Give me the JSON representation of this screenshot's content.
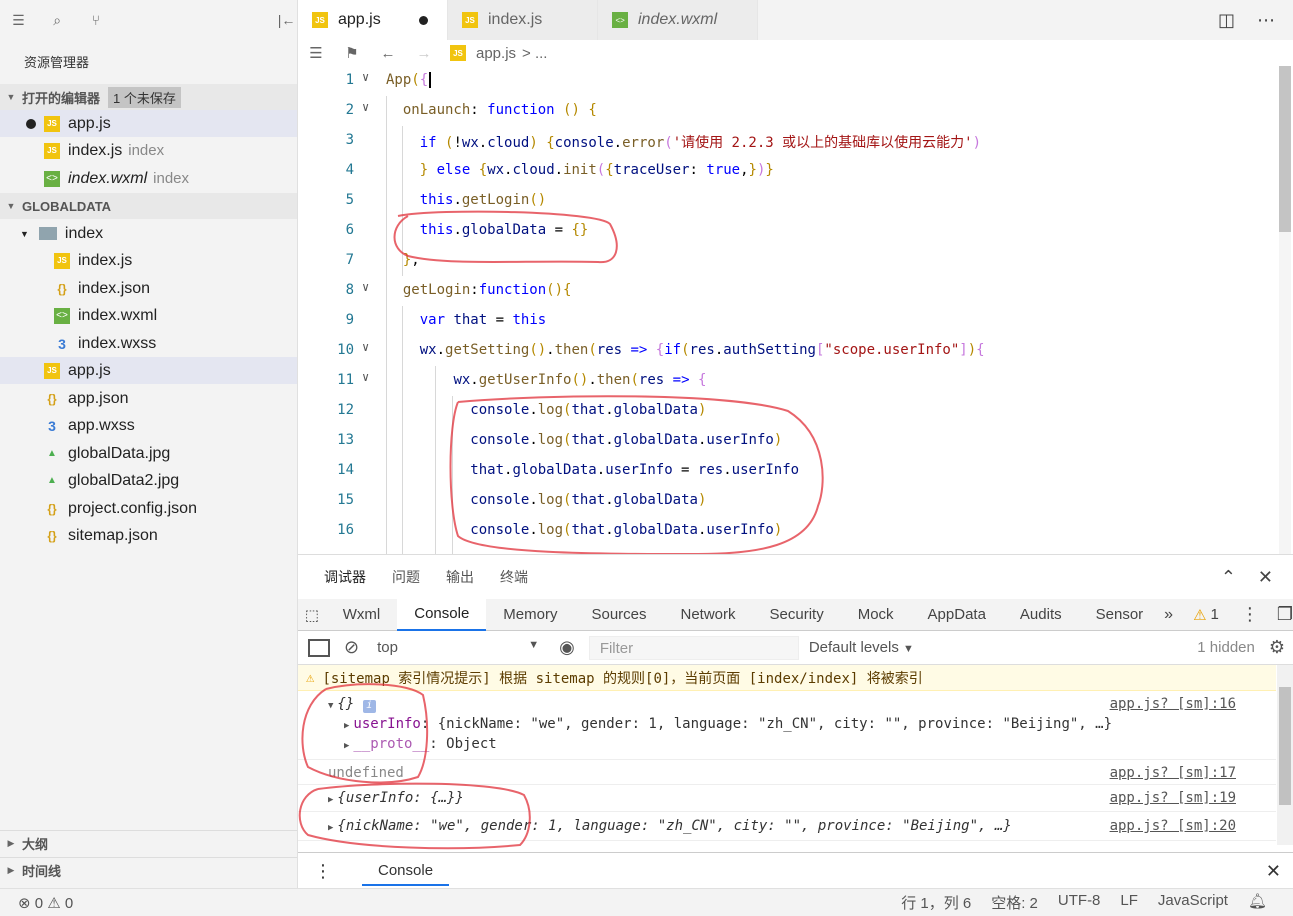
{
  "sidebar": {
    "title": "资源管理器",
    "open_editors": {
      "label": "打开的编辑器",
      "badge": "1 个未保存"
    },
    "open_files": [
      {
        "name": "app.js",
        "hint": ""
      },
      {
        "name": "index.js",
        "hint": "index"
      },
      {
        "name": "index.wxml",
        "hint": "index"
      }
    ],
    "project": "GLOBALDATA",
    "tree": [
      {
        "name": "index"
      },
      {
        "name": "index.js"
      },
      {
        "name": "index.json"
      },
      {
        "name": "index.wxml"
      },
      {
        "name": "index.wxss"
      },
      {
        "name": "app.js"
      },
      {
        "name": "app.json"
      },
      {
        "name": "app.wxss"
      },
      {
        "name": "globalData.jpg"
      },
      {
        "name": "globalData2.jpg"
      },
      {
        "name": "project.config.json"
      },
      {
        "name": "sitemap.json"
      }
    ],
    "outline": "大纲",
    "timeline": "时间线"
  },
  "tabs": [
    {
      "label": "app.js"
    },
    {
      "label": "index.js"
    },
    {
      "label": "index.wxml"
    }
  ],
  "breadcrumb": {
    "file": "app.js",
    "rest": "> ..."
  },
  "line_numbers": [
    "1",
    "2",
    "3",
    "4",
    "5",
    "6",
    "7",
    "8",
    "9",
    "10",
    "11",
    "12",
    "13",
    "14",
    "15",
    "16"
  ],
  "panel": {
    "tabs": [
      "调试器",
      "问题",
      "输出",
      "终端"
    ],
    "devtools_tabs": [
      "Wxml",
      "Console",
      "Memory",
      "Sources",
      "Network",
      "Security",
      "Mock",
      "AppData",
      "Audits",
      "Sensor"
    ],
    "warn_count": "1",
    "context": "top",
    "filter_placeholder": "Filter",
    "levels": "Default levels",
    "hidden": "1 hidden",
    "warning": "[sitemap 索引情况提示] 根据 sitemap 的规则[0]，当前页面 [index/index] 将被索引",
    "log1_obj": "{}",
    "log1_src": "app.js? [sm]:16",
    "log1_userinfo_key": "userInfo",
    "log1_userinfo_val": ": {nickName: \"we\", gender: 1, language: \"zh_CN\", city: \"\", province: \"Beijing\", …}",
    "log1_proto_key": "__proto__",
    "log1_proto_val": ": Object",
    "log2": "undefined",
    "log2_src": "app.js? [sm]:17",
    "log3": "{userInfo: {…}}",
    "log3_src": "app.js? [sm]:19",
    "log4": "{nickName: \"we\", gender: 1, language: \"zh_CN\", city: \"\", province: \"Beijing\", …}",
    "log4_src": "app.js? [sm]:20",
    "drawer_tab": "Console"
  },
  "status": {
    "errors": "0",
    "warnings": "0",
    "position": "行 1，列 6",
    "spaces": "空格: 2",
    "encoding": "UTF-8",
    "eol": "LF",
    "language": "JavaScript"
  }
}
